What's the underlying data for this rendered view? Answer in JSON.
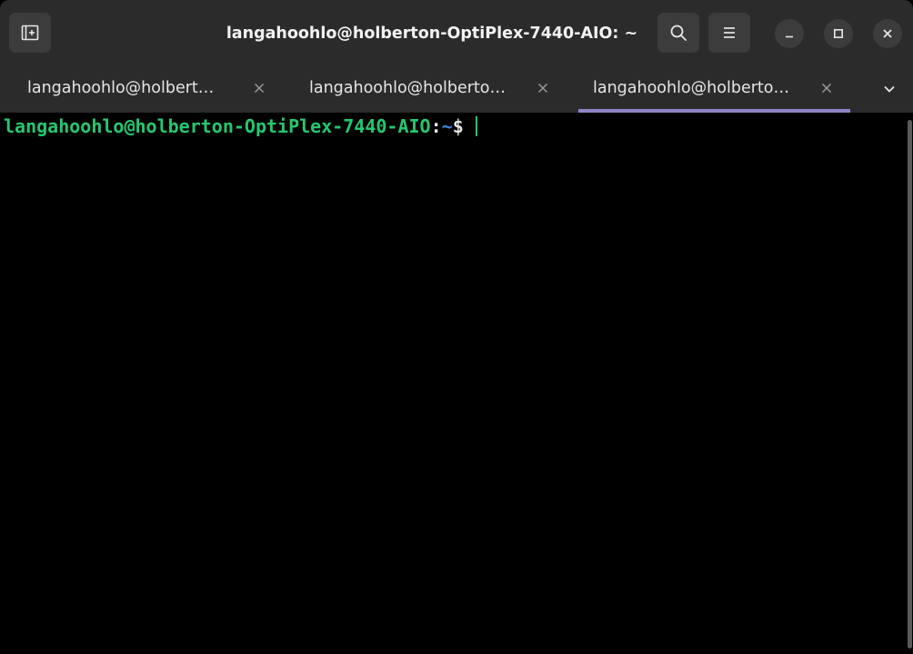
{
  "window": {
    "title": "langahoohlo@holberton-OptiPlex-7440-AIO: ~"
  },
  "headerbar": {
    "buttons": {
      "new_tab": "new-tab-icon",
      "search": "search-icon",
      "menu": "hamburger-menu-icon",
      "minimize": "minimize-icon",
      "maximize": "maximize-icon",
      "close": "close-icon"
    }
  },
  "tabs": [
    {
      "label": "langahoohlo@holbert…",
      "active": false
    },
    {
      "label": "langahoohlo@holberto…",
      "active": false
    },
    {
      "label": "langahoohlo@holberto…",
      "active": true
    }
  ],
  "terminal": {
    "prompt_user_host": "langahoohlo@holberton-OptiPlex-7440-AIO",
    "prompt_separator": ":",
    "prompt_path": "~",
    "prompt_symbol": "$",
    "input": ""
  },
  "colors": {
    "headerbar_bg": "#2b2b2b",
    "terminal_bg": "#000000",
    "prompt_user_color": "#26c76f",
    "prompt_path_color": "#3b88d9",
    "active_tab_indicator": "#8f84c7"
  }
}
